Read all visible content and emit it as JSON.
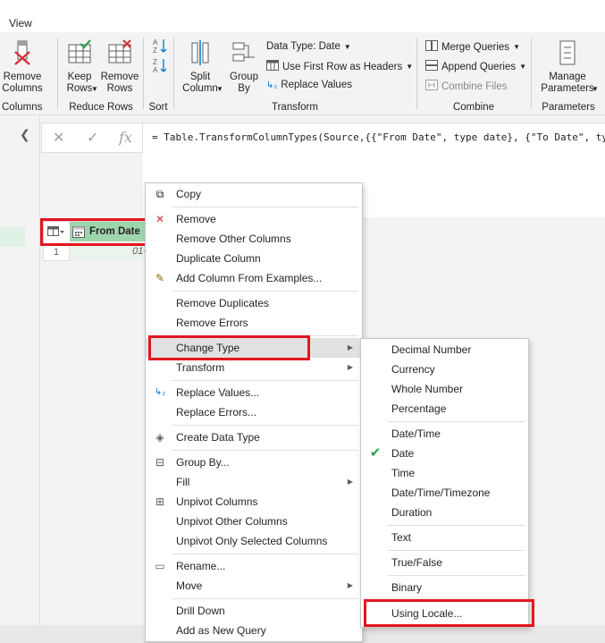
{
  "ribbon": {
    "tab_view": "View",
    "remove_columns": "Remove\nColumns",
    "columns_group": "Columns",
    "keep_rows": "Keep\nRows",
    "remove_rows": "Remove\nRows",
    "reduce_rows_group": "Reduce Rows",
    "sort_group": "Sort",
    "split_column": "Split\nColumn",
    "group_by": "Group\nBy",
    "data_type": "Data Type: Date",
    "use_first_row": "Use First Row as Headers",
    "replace_values": "Replace Values",
    "transform_group": "Transform",
    "merge_queries": "Merge Queries",
    "append_queries": "Append Queries",
    "combine_files": "Combine Files",
    "combine_group": "Combine",
    "manage_parameters": "Manage\nParameters",
    "parameters_group": "Parameters"
  },
  "formula_bar": {
    "text": "= Table.TransformColumnTypes(Source,{{\"From Date\", type date}, {\"To Date\", ty"
  },
  "grid": {
    "column_name": "From Date",
    "row_number": "1",
    "cell_value": "01-"
  },
  "context_menu": {
    "items": [
      "Copy",
      "Remove",
      "Remove Other Columns",
      "Duplicate Column",
      "Add Column From Examples...",
      "Remove Duplicates",
      "Remove Errors",
      "Change Type",
      "Transform",
      "Replace Values...",
      "Replace Errors...",
      "Create Data Type",
      "Group By...",
      "Fill",
      "Unpivot Columns",
      "Unpivot Other Columns",
      "Unpivot Only Selected Columns",
      "Rename...",
      "Move",
      "Drill Down",
      "Add as New Query"
    ]
  },
  "submenu": {
    "items": [
      "Decimal Number",
      "Currency",
      "Whole Number",
      "Percentage",
      "Date/Time",
      "Date",
      "Time",
      "Date/Time/Timezone",
      "Duration",
      "Text",
      "True/False",
      "Binary",
      "Using Locale..."
    ],
    "checked": "Date"
  },
  "colors": {
    "highlight_red": "#e3151f",
    "header_green": "#9fd5ad",
    "check_green": "#2e9e4d"
  }
}
